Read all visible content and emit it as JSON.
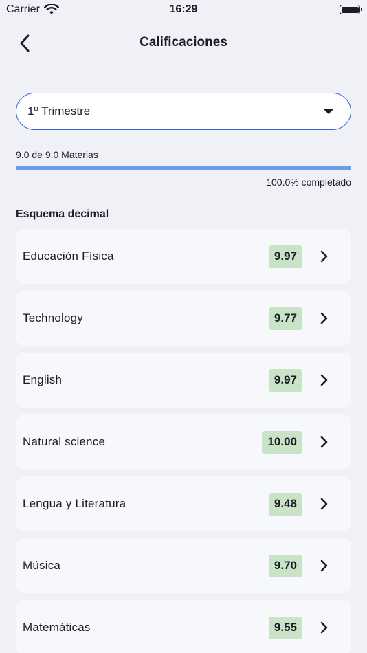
{
  "status_bar": {
    "carrier": "Carrier",
    "time": "16:29",
    "wifi_icon": "wifi-icon",
    "battery_icon": "battery-icon"
  },
  "header": {
    "title": "Calificaciones",
    "back_icon": "chevron-left-icon"
  },
  "period_select": {
    "selected": "1º Trimestre",
    "caret_icon": "caret-down-icon"
  },
  "progress": {
    "label": "9.0 de 9.0 Materias",
    "percent_text": "100.0% completado",
    "fraction": 1.0,
    "color": "#6a9eeb"
  },
  "section": {
    "title": "Esquema decimal"
  },
  "subjects": [
    {
      "name": "Educación Física",
      "grade": "9.97"
    },
    {
      "name": "Technology",
      "grade": "9.77"
    },
    {
      "name": "English",
      "grade": "9.97"
    },
    {
      "name": "Natural science",
      "grade": "10.00"
    },
    {
      "name": "Lengua y Literatura",
      "grade": "9.48"
    },
    {
      "name": "Música",
      "grade": "9.70"
    },
    {
      "name": "Matemáticas",
      "grade": "9.55"
    }
  ],
  "colors": {
    "accent": "#2f67d6",
    "grade_badge": "#c9e3c6",
    "card": "#f7f8fb",
    "background": "#f0f1f6"
  }
}
